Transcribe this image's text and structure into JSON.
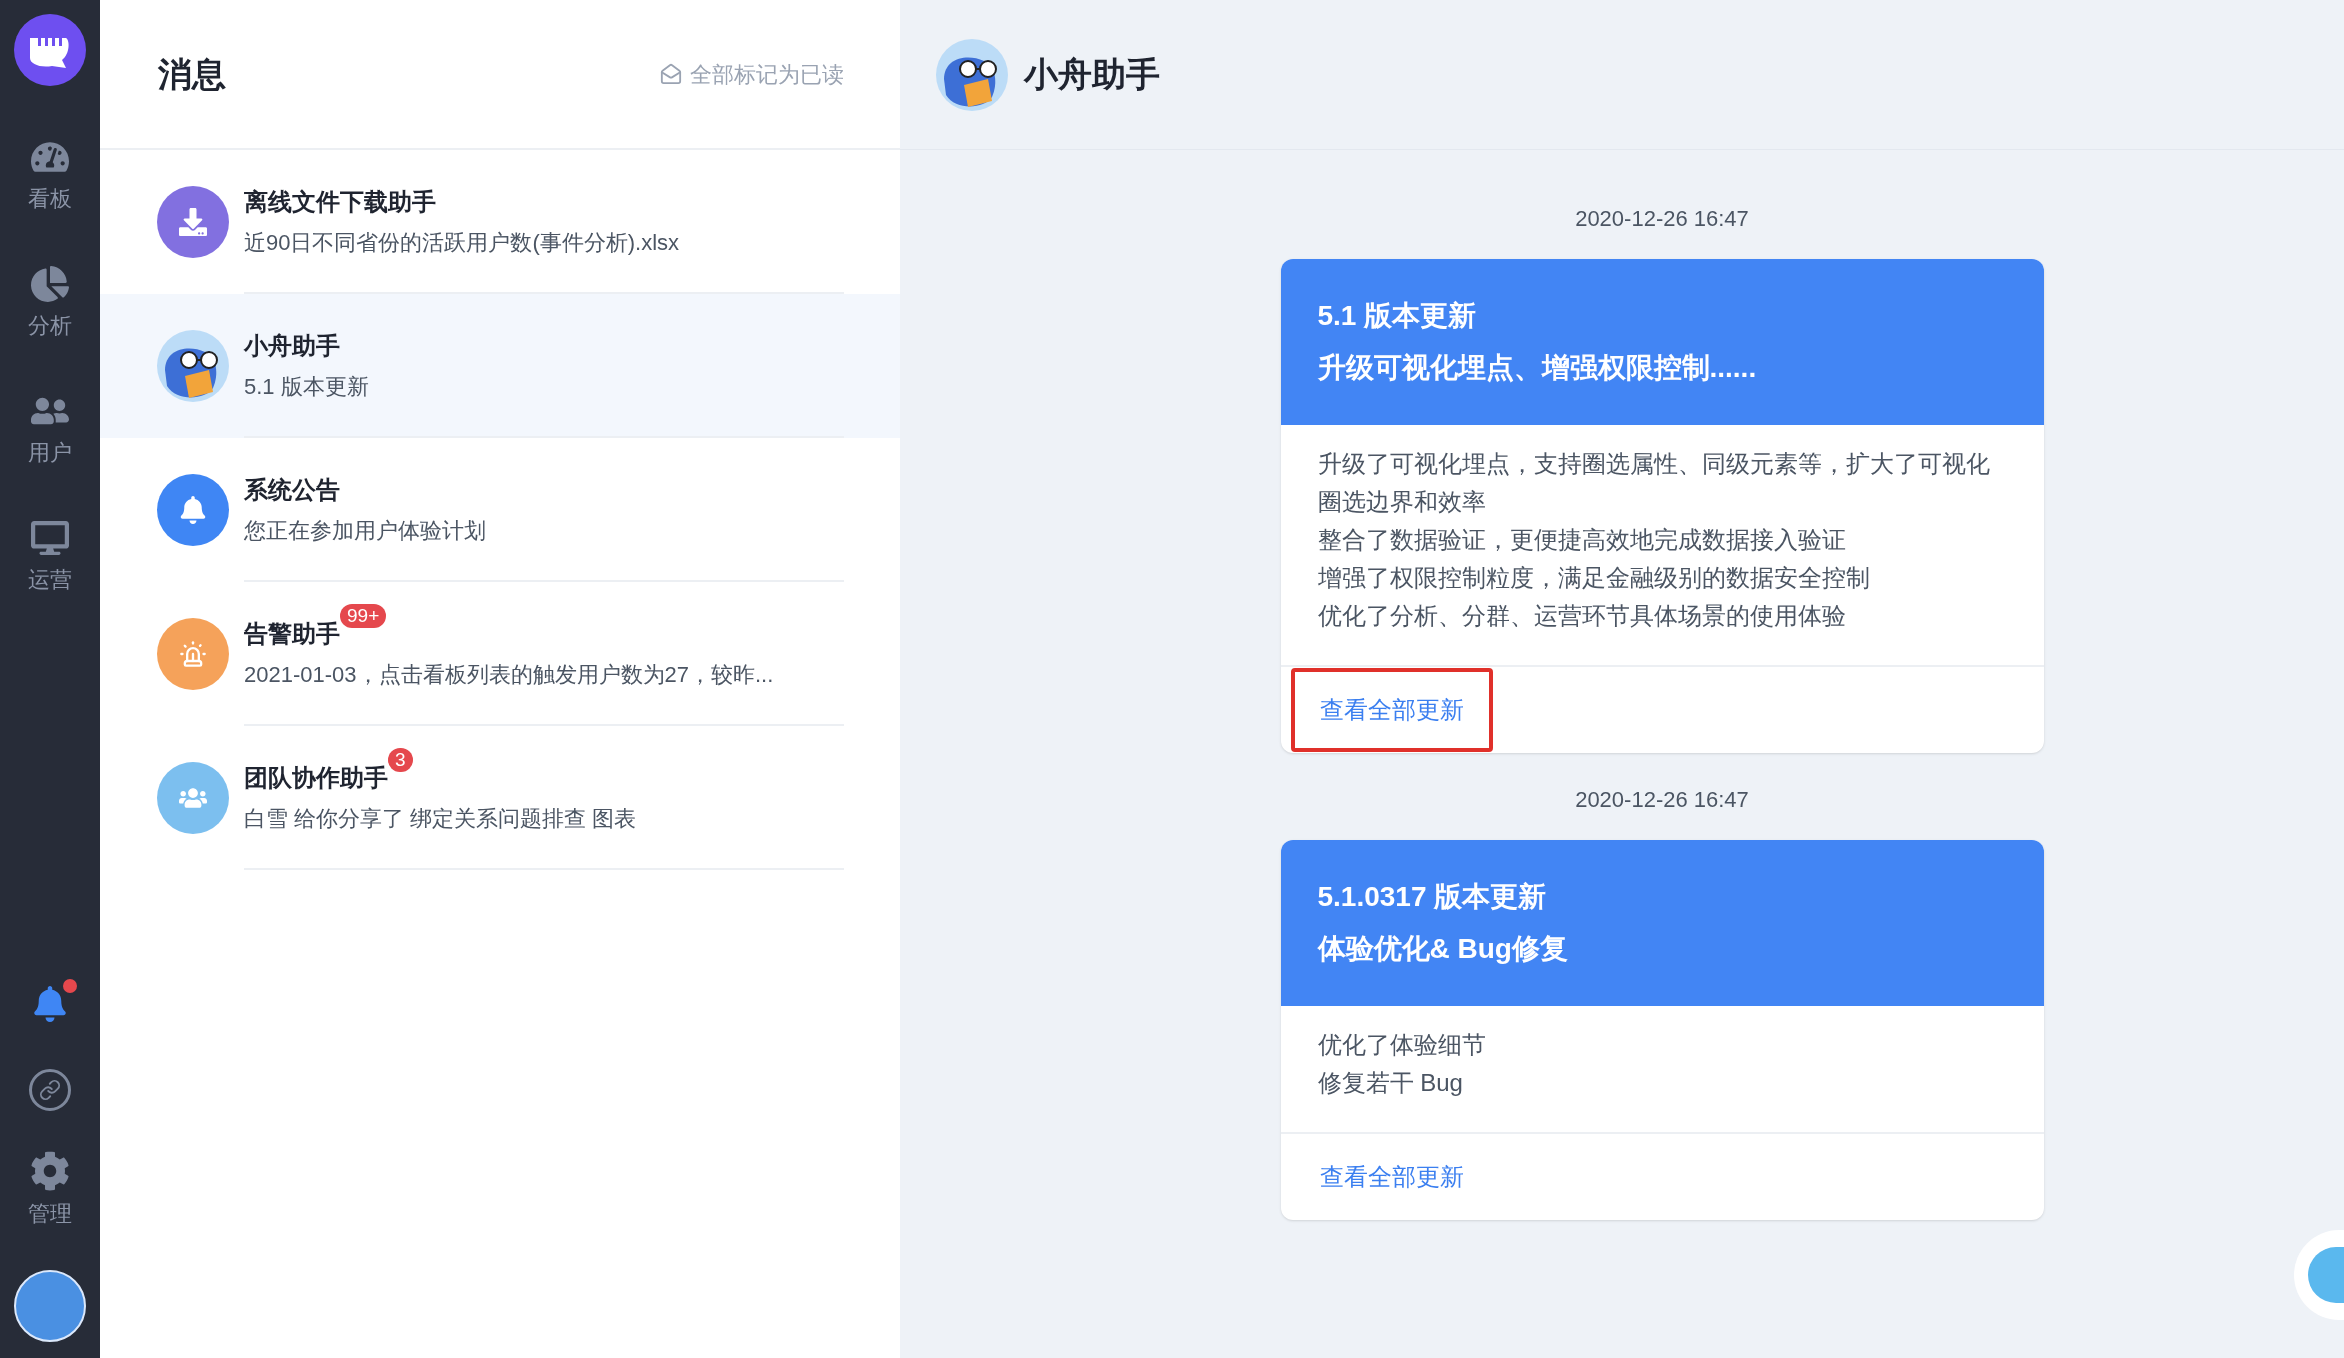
{
  "sidebar": {
    "nav": [
      {
        "kind": "dashboard",
        "label": "看板"
      },
      {
        "kind": "analysis",
        "label": "分析"
      },
      {
        "kind": "users",
        "label": "用户"
      },
      {
        "kind": "operations",
        "label": "运营"
      }
    ],
    "notification_dot": true,
    "settings": {
      "label": "管理"
    }
  },
  "message_list": {
    "title": "消息",
    "mark_all_read": "全部标记为已读",
    "items": [
      {
        "kind": "download",
        "color": "#8270e0",
        "title": "离线文件下载助手",
        "preview": "近90日不同省份的活跃用户数(事件分析).xlsx",
        "selected": false
      },
      {
        "kind": "mascot",
        "title": "小舟助手",
        "preview": "5.1 版本更新",
        "selected": true
      },
      {
        "kind": "bell",
        "color": "#3f86f4",
        "title": "系统公告",
        "preview": "您正在参加用户体验计划",
        "selected": false
      },
      {
        "kind": "alarm",
        "color": "#f5a25a",
        "title": "告警助手",
        "badge": "99+",
        "preview": "2021-01-03，点击看板列表的触发用户数为27，较昨...",
        "selected": false
      },
      {
        "kind": "team",
        "color": "#7cbfef",
        "title": "团队协作助手",
        "badge": "3",
        "preview": "白雪 给你分享了 绑定关系问题排查 图表",
        "selected": false
      }
    ]
  },
  "chat": {
    "title": "小舟助手",
    "updates": [
      {
        "time": "2020-12-26 16:47",
        "title": "5.1 版本更新",
        "subtitle": "升级可视化埋点、增强权限控制......",
        "lines": [
          "升级了可视化埋点，支持圈选属性、同级元素等，扩大了可视化圈选边界和效率",
          "整合了数据验证，更便捷高效地完成数据接入验证",
          "增强了权限控制粒度，满足金融级别的数据安全控制",
          "优化了分析、分群、运营环节具体场景的使用体验"
        ],
        "link": "查看全部更新",
        "highlighted": true
      },
      {
        "time": "2020-12-26 16:47",
        "title": "5.1.0317 版本更新",
        "subtitle": "体验优化& Bug修复",
        "lines": [
          "优化了体验细节",
          "修复若干 Bug"
        ],
        "link": "查看全部更新",
        "highlighted": false
      }
    ]
  }
}
